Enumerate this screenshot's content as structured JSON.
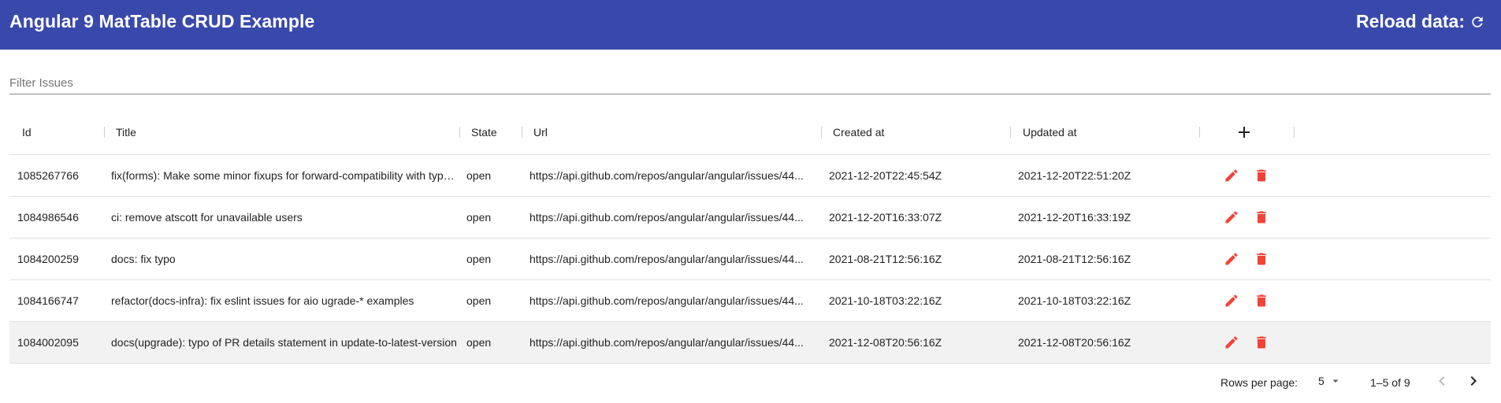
{
  "toolbar": {
    "title": "Angular 9 MatTable CRUD Example",
    "reload_label": "Reload data:",
    "reload_icon": "refresh-icon",
    "color": "#3949ab"
  },
  "filter": {
    "placeholder": "Filter Issues",
    "value": ""
  },
  "table": {
    "columns": [
      "Id",
      "Title",
      "State",
      "Url",
      "Created at",
      "Updated at"
    ],
    "add_icon": "plus-icon",
    "rows": [
      {
        "id": "1085267766",
        "title": "fix(forms): Make some minor fixups for forward-compatibility with typed forms",
        "state": "open",
        "url": "https://api.github.com/repos/angular/angular/issues/44...",
        "created": "2021-12-20T22:45:54Z",
        "updated": "2021-12-20T22:51:20Z"
      },
      {
        "id": "1084986546",
        "title": "ci: remove atscott for unavailable users",
        "state": "open",
        "url": "https://api.github.com/repos/angular/angular/issues/44...",
        "created": "2021-12-20T16:33:07Z",
        "updated": "2021-12-20T16:33:19Z"
      },
      {
        "id": "1084200259",
        "title": "docs: fix typo",
        "state": "open",
        "url": "https://api.github.com/repos/angular/angular/issues/44...",
        "created": "2021-08-21T12:56:16Z",
        "updated": "2021-08-21T12:56:16Z"
      },
      {
        "id": "1084166747",
        "title": "refactor(docs-infra): fix eslint issues for aio ugrade-* examples",
        "state": "open",
        "url": "https://api.github.com/repos/angular/angular/issues/44...",
        "created": "2021-10-18T03:22:16Z",
        "updated": "2021-10-18T03:22:16Z"
      },
      {
        "id": "1084002095",
        "title": "docs(upgrade): typo of PR details statement in update-to-latest-version",
        "state": "open",
        "url": "https://api.github.com/repos/angular/angular/issues/44...",
        "created": "2021-12-08T20:56:16Z",
        "updated": "2021-12-08T20:56:16Z"
      }
    ],
    "action_icons": {
      "edit": "pencil-icon",
      "delete": "trash-icon"
    },
    "action_color": "#f44336"
  },
  "paginator": {
    "rows_per_page_label": "Rows per page:",
    "page_size": "5",
    "range": "1–5 of 9"
  }
}
